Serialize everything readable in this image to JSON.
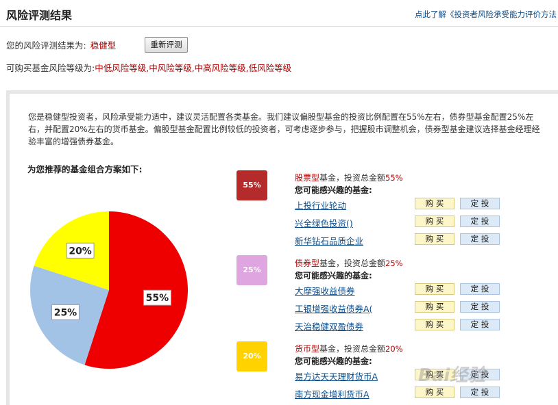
{
  "header": {
    "title": "风险评测结果",
    "link": "点此了解《投资者风险承受能力评价方法"
  },
  "result": {
    "label": "您的风险评测结果为:",
    "value": "稳健型",
    "retest_button": "重新评测"
  },
  "levels": {
    "label": "可购买基金风险等级为:",
    "value": "中低风险等级,中风险等级,中高风险等级,低风险等级"
  },
  "description": "您是稳健型投资者，风险承受能力适中，建议灵活配置各类基金。我们建议偏股型基金的投资比例配置在55%左右，债券型基金配置25%左右，并配置20%左右的货币基金。偏股型基金配置比例较低的投资者，可考虑逐步参与，把握股市调整机会，债券型基金建议选择基金经理经验丰富的增强债券基金。",
  "recommend_title": "为您推荐的基金组合方案如下:",
  "chart_data": {
    "type": "pie",
    "values": [
      55,
      25,
      20
    ],
    "labels": [
      "55%",
      "25%",
      "20%"
    ],
    "colors": [
      "#ee0000",
      "#a3c3e6",
      "#ffff00"
    ]
  },
  "groups": [
    {
      "badge": "55%",
      "color": "#b52a2a",
      "type": "股票型",
      "suffix": "基金，投资总金额",
      "pct": "55%",
      "sub": "您可能感兴趣的基金:",
      "funds": [
        {
          "name": "上投行业轮动",
          "buy": "购 买",
          "invest": "定 投"
        },
        {
          "name": "兴全绿色投资()",
          "buy": "购 买",
          "invest": "定 投"
        },
        {
          "name": "新华钻石品质企业",
          "buy": "购 买",
          "invest": "定 投"
        }
      ]
    },
    {
      "badge": "25%",
      "color": "#dfa5e0",
      "type": "债券型",
      "suffix": "基金，投资总金额",
      "pct": "25%",
      "sub": "您可能感兴趣的基金:",
      "funds": [
        {
          "name": "大摩强收益债券",
          "buy": "购 买",
          "invest": "定 投"
        },
        {
          "name": "工银增强收益债券A(",
          "buy": "购 买",
          "invest": "定 投"
        },
        {
          "name": "天治稳健双盈债券",
          "buy": "购 买",
          "invest": "定 投"
        }
      ]
    },
    {
      "badge": "20%",
      "color": "#ffd200",
      "type": "货币型",
      "suffix": "基金，投资总金额",
      "pct": "20%",
      "sub": "您可能感兴趣的基金:",
      "funds": [
        {
          "name": "易方达天天理财货币A",
          "buy": "购 买",
          "invest": "定 投"
        },
        {
          "name": "南方现金增利货币A",
          "buy": "购 买",
          "invest": "定 投"
        }
      ]
    }
  ],
  "watermark": "Bai经验"
}
